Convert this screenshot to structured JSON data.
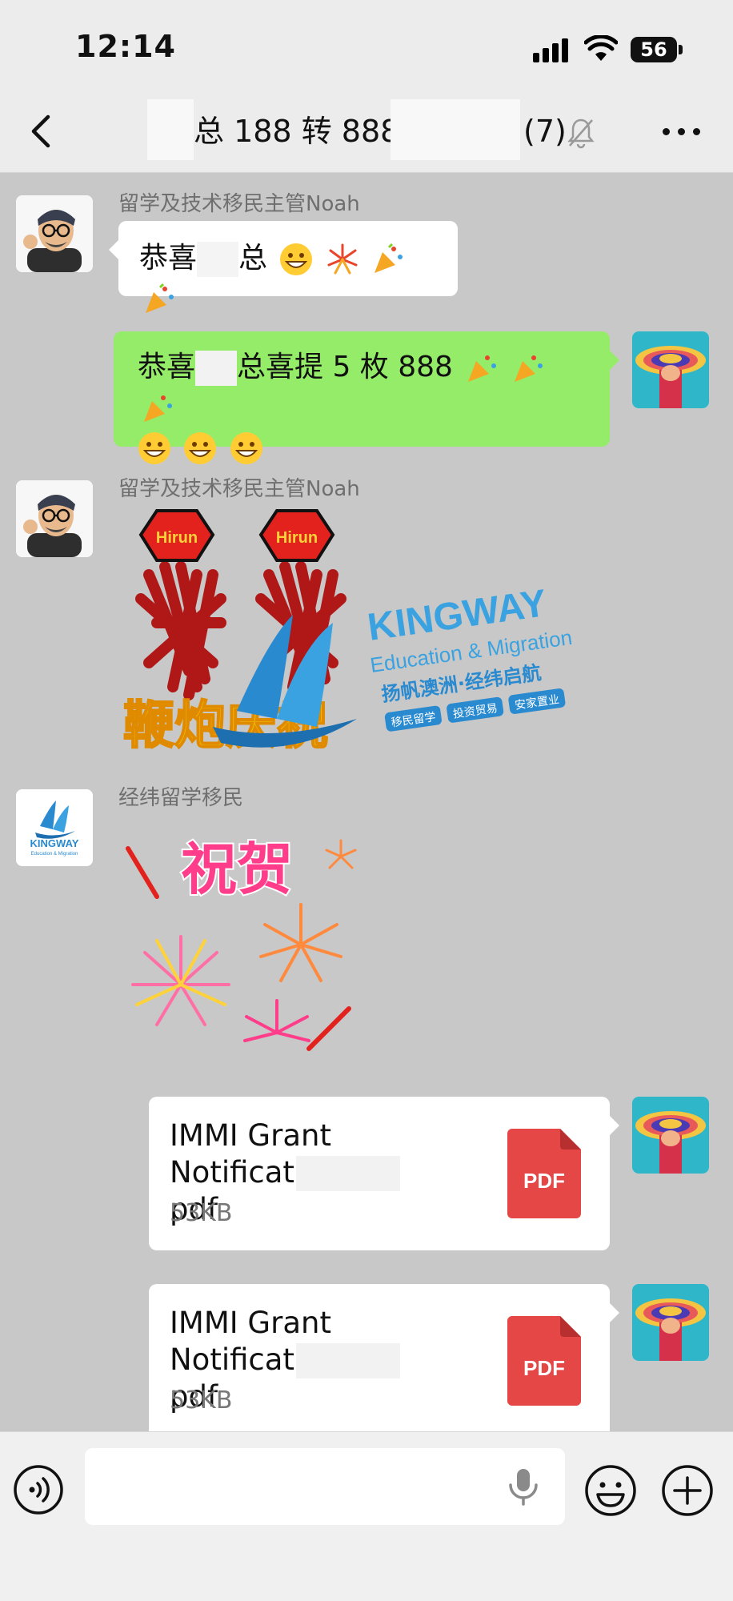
{
  "status_bar": {
    "time": "12:14",
    "battery": "56"
  },
  "nav": {
    "title": "总 188 转 888",
    "count": "(7)"
  },
  "messages": [
    {
      "sender": "留学及技术移民主管Noah",
      "text_before": "恭喜",
      "text_after": "总"
    },
    {
      "text_before": "恭喜",
      "text_after": "总喜提 5 枚 888"
    },
    {
      "sender": "留学及技术移民主管Noah",
      "sticker": {
        "badge": "Hirun",
        "caption": "鞭炮庆祝",
        "brand": "KINGWAY",
        "brand_sub": "Education & Migration",
        "slogan": "扬帆澳洲·经纬启航",
        "tags": [
          "移民留学",
          "投资贸易",
          "安家置业"
        ]
      }
    },
    {
      "sender": "经纬留学移民",
      "sticker": {
        "caption": "祝贺"
      }
    }
  ],
  "files": [
    {
      "name_line1": "IMMI Grant",
      "name_line2_start": "Notificati...",
      "name_line2_end": "pdf",
      "size": "53KB",
      "type_label": "PDF"
    },
    {
      "name_line1": "IMMI Grant",
      "name_line2_start": "Notificati...",
      "name_line2_end": "pdf",
      "size": "53KB",
      "type_label": "PDF"
    }
  ],
  "avatars": {
    "noah": "memoji-glasses-avatar",
    "me": "rainbow-hat-portrait-avatar",
    "kingway": "kingway-logo-avatar",
    "kingway_label": "KINGWAY",
    "kingway_sub": "Education & Migration"
  },
  "input": {
    "value": "",
    "placeholder": ""
  },
  "colors": {
    "sent_bubble": "#95ec69",
    "received_bubble": "#ffffff",
    "chat_bg": "#c8c8c8",
    "pdf_red": "#e54646",
    "kingway_blue": "#3aa2e0"
  }
}
